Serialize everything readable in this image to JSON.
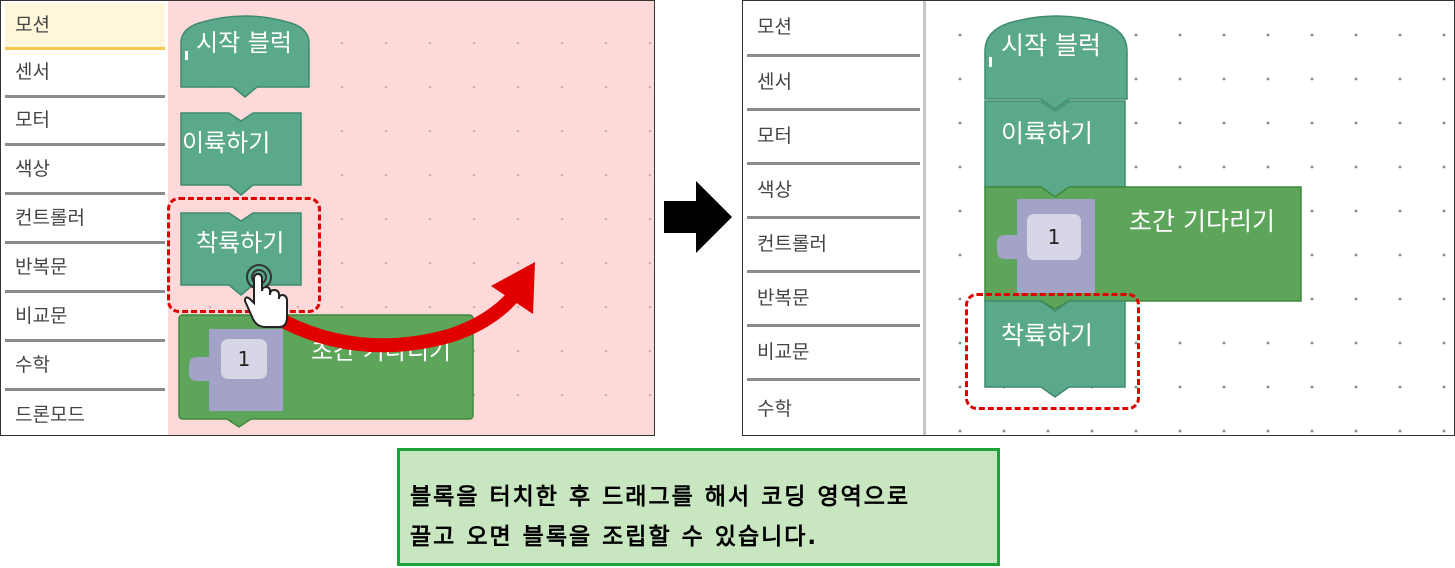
{
  "left_panel": {
    "categories": [
      "모션",
      "센서",
      "모터",
      "색상",
      "컨트롤러",
      "반복문",
      "비교문",
      "수학",
      "드론모드"
    ],
    "selected_category": "모션",
    "blocks": {
      "start": "시작 블럭",
      "takeoff": "이륙하기",
      "land": "착륙하기",
      "wait": "초간 기다리기",
      "wait_value": "1"
    }
  },
  "right_panel": {
    "categories": [
      "모션",
      "센서",
      "모터",
      "색상",
      "컨트롤러",
      "반복문",
      "비교문",
      "수학"
    ],
    "blocks": {
      "start": "시작 블럭",
      "takeoff": "이륙하기",
      "wait": "초간 기다리기",
      "wait_value": "1",
      "land": "착륙하기"
    }
  },
  "caption": {
    "line1": "블록을 터치한 후 드래그를 해서 코딩 영역으로",
    "line2": "끌고 오면 블록을 조립할 수 있습니다."
  },
  "colors": {
    "teal_block": "#5aa98a",
    "green_block": "#5da55a",
    "number_slot": "#a3a3c8",
    "left_workspace": "#fdd9d9",
    "highlight_dash": "#e00000",
    "caption_bg": "#c8e6c0",
    "caption_border": "#1fa23a"
  },
  "icons": [
    "hand-pointer-icon",
    "curved-arrow-icon",
    "right-arrow-icon",
    "puzzle-tab-icon"
  ]
}
